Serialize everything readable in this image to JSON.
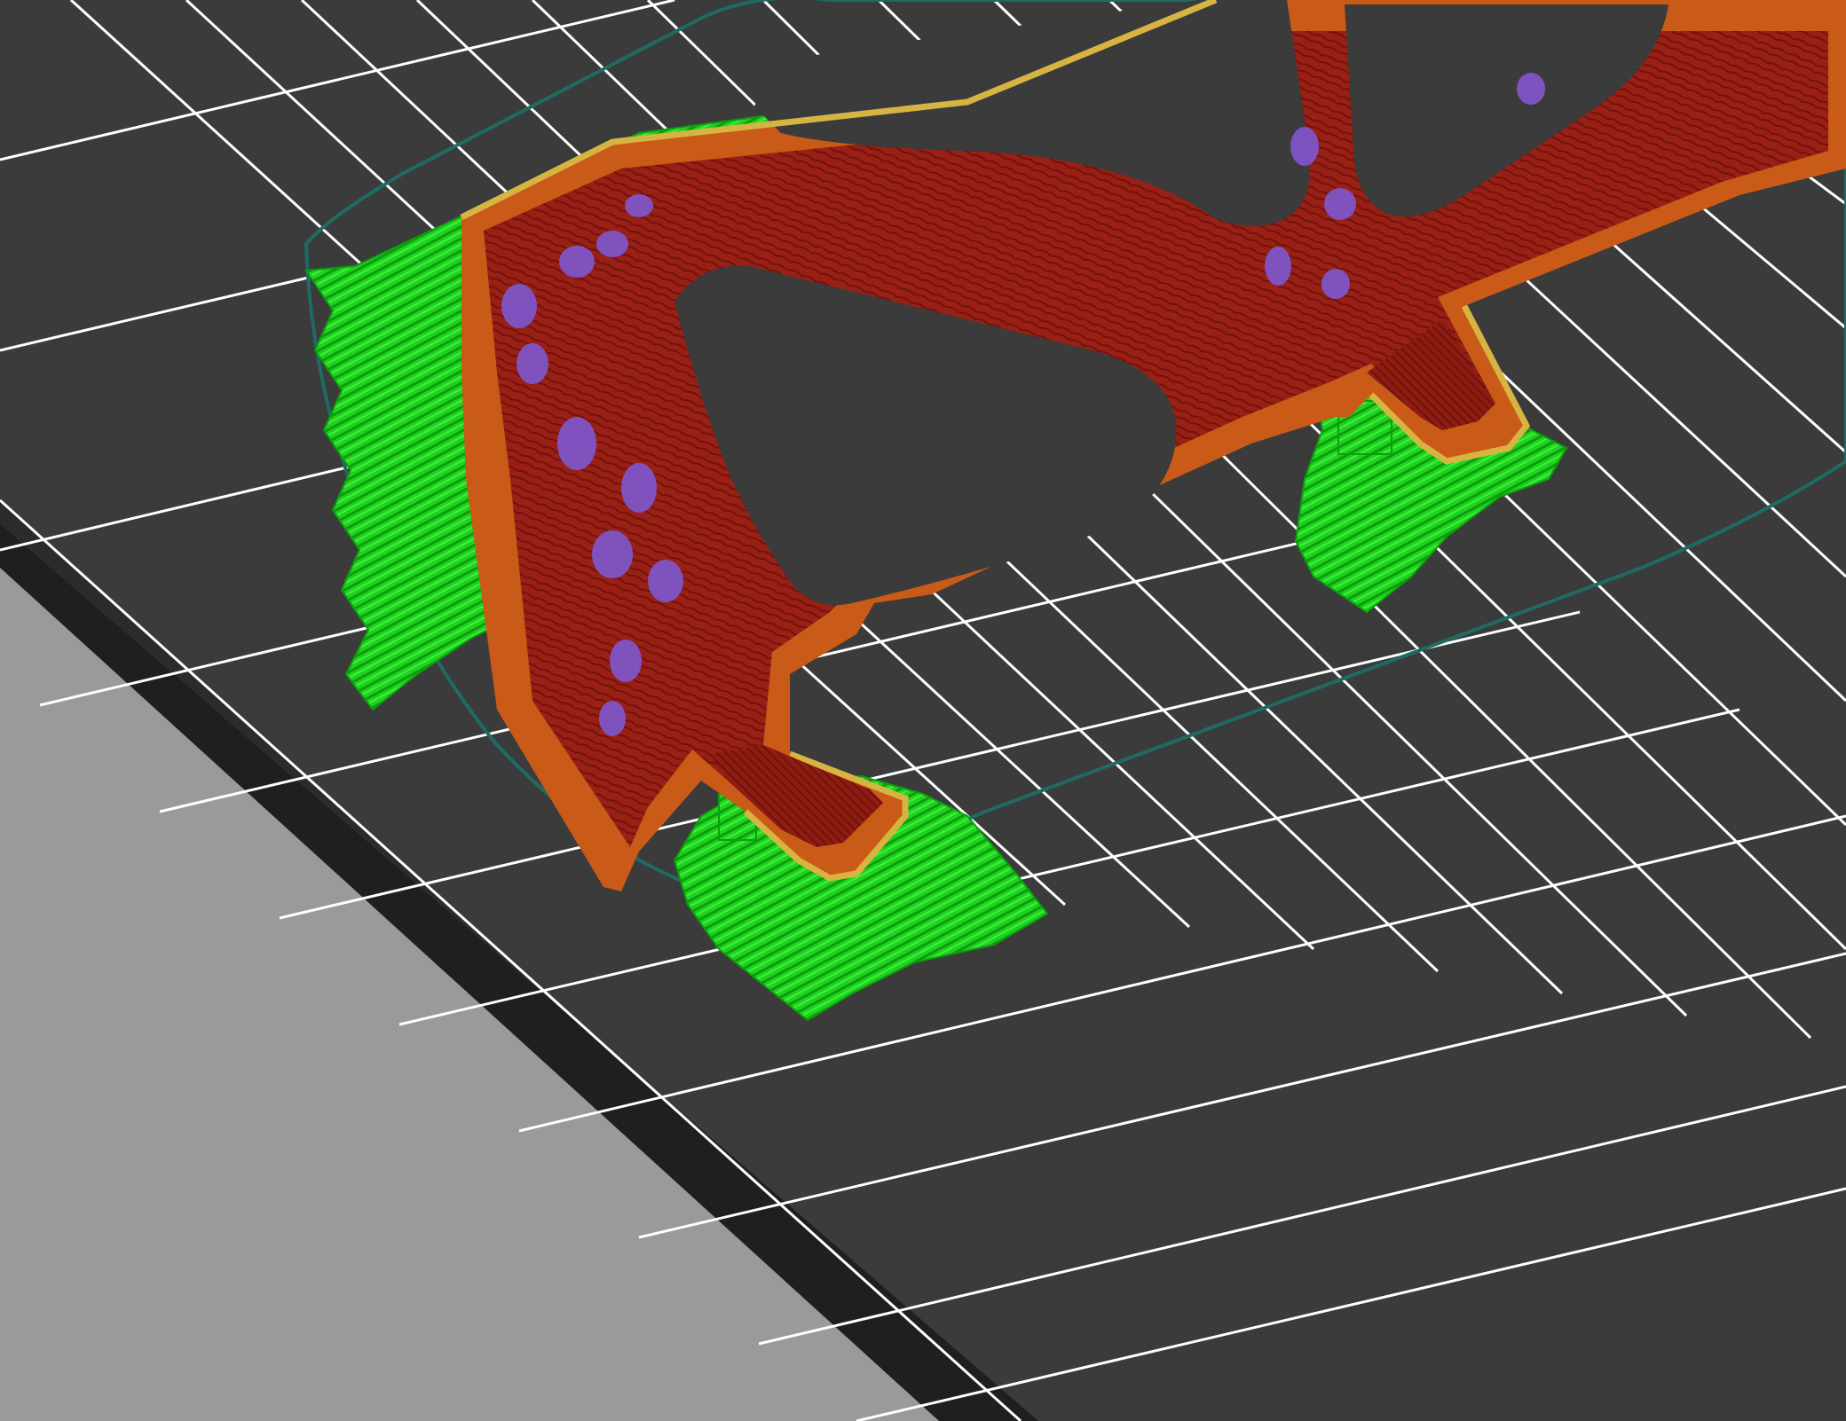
{
  "viewer": {
    "view_type": "3D slicer layer preview",
    "bed_surface_color": "#3b3b3b",
    "bed_edge_color": "#2a2a2a",
    "background_color": "#9a9a9a",
    "grid_minor_color": "#ffffff",
    "grid_major_color": "#ffffff",
    "skirt_color": "#1f6b63"
  },
  "feature_colors": {
    "support_material": "#1fd21f",
    "perimeter": "#d8681f",
    "external_perimeter": "#c95a18",
    "infill": "#9a1f14",
    "solid_infill": "#8f1c12",
    "overhang_perimeter": "#d7b441",
    "bridge_infill": "#7f55c8"
  },
  "icons": {
    "scene": "print-bed-preview-icon"
  }
}
